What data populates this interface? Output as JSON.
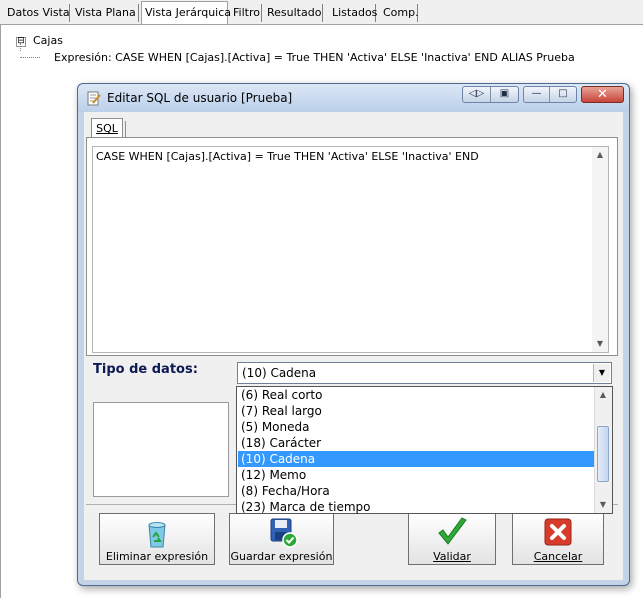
{
  "tabs": [
    {
      "label": "Datos Vista",
      "active": false
    },
    {
      "label": "Vista Plana",
      "active": false
    },
    {
      "label": "Vista Jerárquica",
      "active": true
    },
    {
      "label": "Filtro",
      "active": false
    },
    {
      "label": "Resultado",
      "active": false
    },
    {
      "label": "Listados",
      "active": false
    },
    {
      "label": "Comp.",
      "active": false
    }
  ],
  "tree": {
    "expander": "⊟",
    "root": "Cajas",
    "child": "Expresión: CASE WHEN [Cajas].[Activa] = True THEN 'Activa' ELSE 'Inactiva' END ALIAS Prueba"
  },
  "dialog": {
    "title": "Editar SQL de usuario [Prueba]",
    "title_icon": "edit-document-icon",
    "sql_tab": "SQL",
    "sql_text": "CASE WHEN [Cajas].[Activa] = True THEN 'Activa' ELSE 'Inactiva' END",
    "data_type_label": "Tipo de datos:",
    "data_type_value": "(10) Cadena",
    "dropdown_options": [
      "(6) Real corto",
      "(7) Real largo",
      "(5) Moneda",
      "(18) Carácter",
      "(10) Cadena",
      "(12) Memo",
      "(8) Fecha/Hora",
      "(23) Marca de tiempo"
    ],
    "dropdown_selected_index": 4,
    "buttons": {
      "delete": "Eliminar expresión",
      "save": "Guardar expresión",
      "validate": "Validar",
      "cancel": "Cancelar"
    }
  },
  "colors": {
    "selection": "#3399ff",
    "dialog_frame": "#c4d4e8",
    "close_button": "#c7443b",
    "validate_check": "#2fa83a",
    "cancel_x": "#d63b2b"
  }
}
